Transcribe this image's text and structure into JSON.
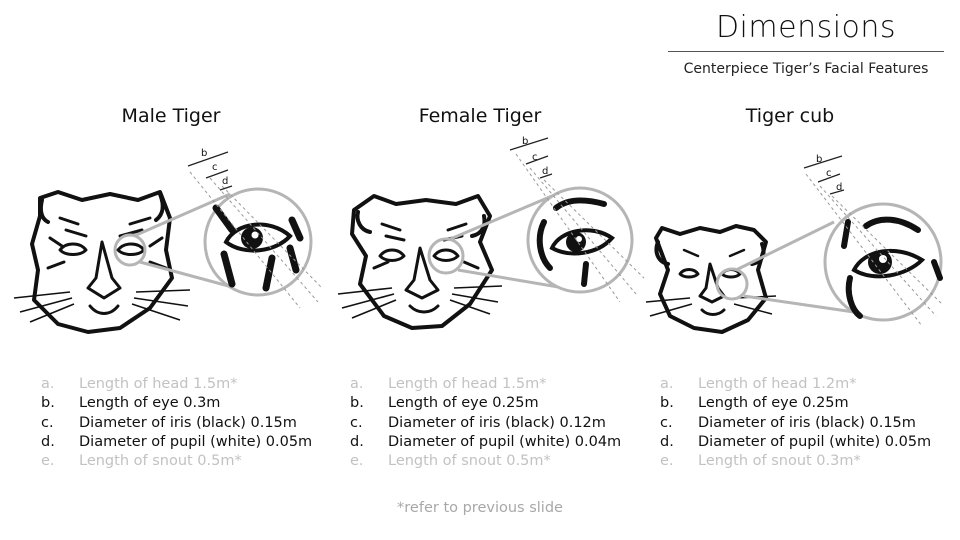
{
  "header": {
    "title": "Dimensions",
    "subtitle": "Centerpiece Tiger’s Facial Features"
  },
  "panels": [
    {
      "heading": "Male Tiger",
      "dimension_labels": [
        "b",
        "c",
        "d"
      ],
      "items": [
        {
          "letter": "a.",
          "text": "Length of head 1.5m*",
          "muted": true
        },
        {
          "letter": "b.",
          "text": "Length of eye 0.3m",
          "muted": false
        },
        {
          "letter": "c.",
          "text": "Diameter of iris (black) 0.15m",
          "muted": false
        },
        {
          "letter": "d.",
          "text": "Diameter of pupil (white) 0.05m",
          "muted": false
        },
        {
          "letter": "e.",
          "text": "Length of snout 0.5m*",
          "muted": true
        }
      ]
    },
    {
      "heading": "Female Tiger",
      "dimension_labels": [
        "b",
        "c",
        "d"
      ],
      "items": [
        {
          "letter": "a.",
          "text": "Length of head 1.5m*",
          "muted": true
        },
        {
          "letter": "b.",
          "text": "Length of eye 0.25m",
          "muted": false
        },
        {
          "letter": "c.",
          "text": "Diameter of iris (black) 0.12m",
          "muted": false
        },
        {
          "letter": "d.",
          "text": "Diameter of pupil (white) 0.04m",
          "muted": false
        },
        {
          "letter": "e.",
          "text": "Length of snout 0.5m*",
          "muted": true
        }
      ]
    },
    {
      "heading": "Tiger cub",
      "dimension_labels": [
        "b",
        "c",
        "d"
      ],
      "items": [
        {
          "letter": "a.",
          "text": "Length of head 1.2m*",
          "muted": true
        },
        {
          "letter": "b.",
          "text": "Length of eye 0.25m",
          "muted": false
        },
        {
          "letter": "c.",
          "text": "Diameter of iris (black) 0.15m",
          "muted": false
        },
        {
          "letter": "d.",
          "text": "Diameter of pupil (white) 0.05m",
          "muted": false
        },
        {
          "letter": "e.",
          "text": "Length of snout 0.3m*",
          "muted": true
        }
      ]
    }
  ],
  "footnote": "*refer to previous slide",
  "colors": {
    "text": "#111111",
    "muted_text": "#c2c2c2",
    "footnote": "#a8a8a8",
    "magnifier_ring": "#b5b5b5",
    "line_art": "#111111"
  }
}
